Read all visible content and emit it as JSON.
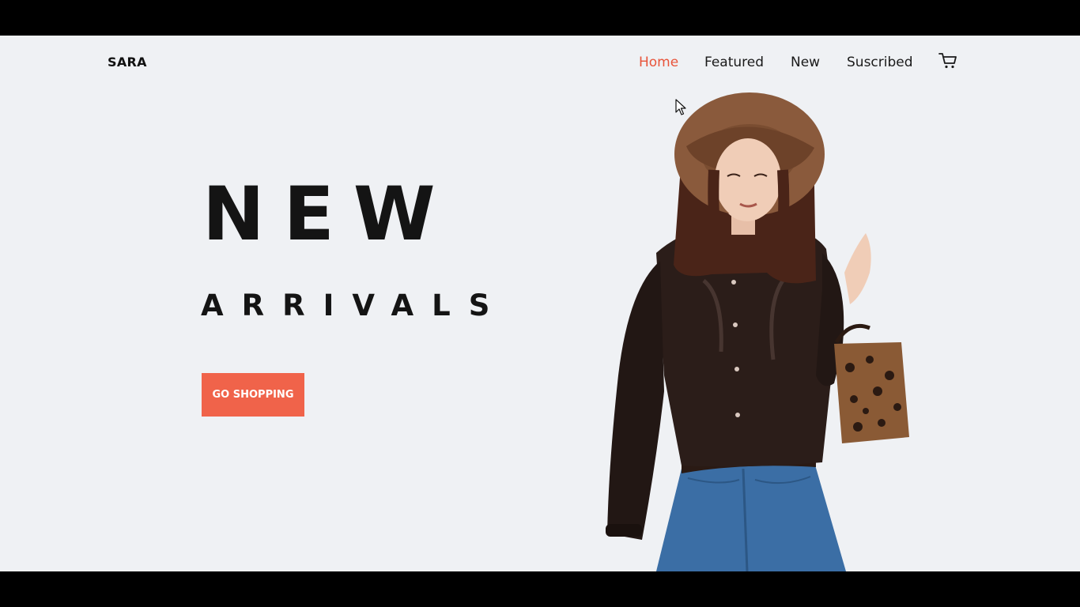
{
  "header": {
    "logo": "SARA",
    "nav": [
      {
        "label": "Home",
        "active": true
      },
      {
        "label": "Featured",
        "active": false
      },
      {
        "label": "New",
        "active": false
      },
      {
        "label": "Suscribed",
        "active": false
      }
    ],
    "cart_icon": "cart-icon"
  },
  "hero": {
    "title": "NEW",
    "subtitle": "ARRIVALS",
    "cta_label": "GO SHOPPING"
  },
  "colors": {
    "accent": "#f0634a",
    "active_nav": "#e8543a",
    "background": "#eff1f4",
    "text": "#141414"
  }
}
